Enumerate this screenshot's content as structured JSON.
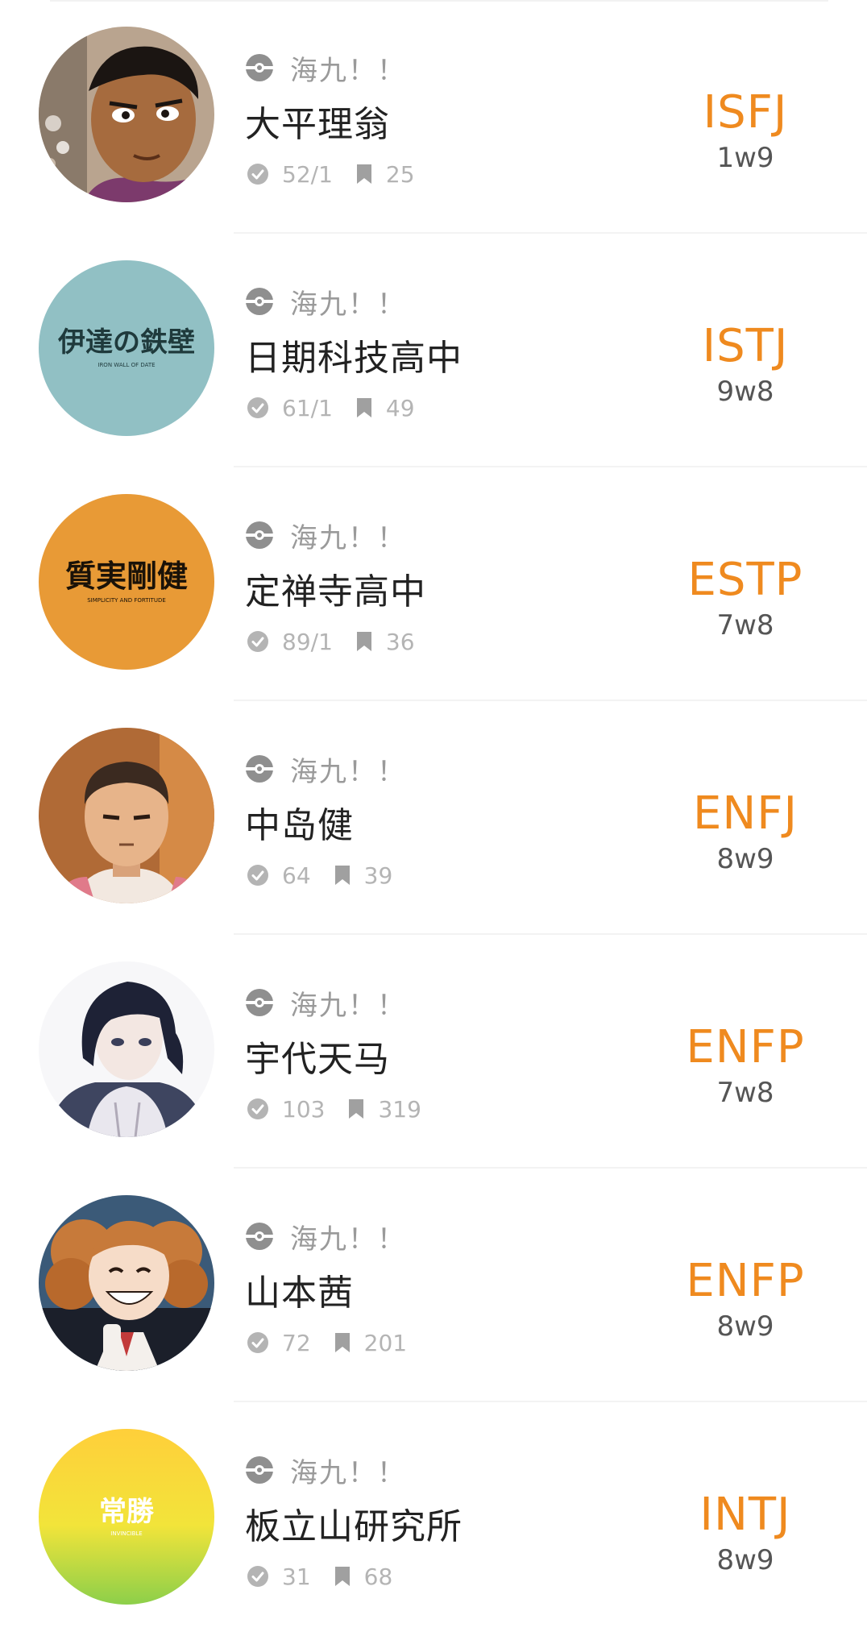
{
  "colors": {
    "mbti": "#ef8a1f",
    "title": "#222222",
    "muted": "#9a9a9a",
    "stats": "#b4b4b4",
    "enneagram": "#555555"
  },
  "items": [
    {
      "avatar": "avatar-character-tan-boy",
      "author": "海九！！",
      "title": "大平理翁",
      "votes": "52/1",
      "bookmarks": "25",
      "mbti": "ISFJ",
      "enneagram": "1w9"
    },
    {
      "avatar": "avatar-logo-teal",
      "avatar_text": "伊達の鉄壁",
      "avatar_subtext": "IRON WALL OF DATE",
      "author": "海九！！",
      "title": "日期科技高中",
      "votes": "61/1",
      "bookmarks": "49",
      "mbti": "ISTJ",
      "enneagram": "9w8"
    },
    {
      "avatar": "avatar-logo-orange",
      "avatar_text": "質実剛健",
      "avatar_subtext": "SIMPLICITY AND FORTITUDE",
      "author": "海九！！",
      "title": "定禅寺高中",
      "votes": "89/1",
      "bookmarks": "36",
      "mbti": "ESTP",
      "enneagram": "7w8"
    },
    {
      "avatar": "avatar-character-buzzcut",
      "author": "海九！！",
      "title": "中岛健",
      "votes": "64",
      "bookmarks": "39",
      "mbti": "ENFJ",
      "enneagram": "8w9"
    },
    {
      "avatar": "avatar-character-dark-hair-hoodie",
      "author": "海九！！",
      "title": "宇代天马",
      "votes": "103",
      "bookmarks": "319",
      "mbti": "ENFP",
      "enneagram": "7w8"
    },
    {
      "avatar": "avatar-character-curly-hair",
      "author": "海九！！",
      "title": "山本茜",
      "votes": "72",
      "bookmarks": "201",
      "mbti": "ENFP",
      "enneagram": "8w9"
    },
    {
      "avatar": "avatar-logo-gradient",
      "avatar_text": "常勝",
      "avatar_subtext": "INVINCIBLE",
      "author": "海九！！",
      "title": "板立山研究所",
      "votes": "31",
      "bookmarks": "68",
      "mbti": "INTJ",
      "enneagram": "8w9"
    }
  ]
}
